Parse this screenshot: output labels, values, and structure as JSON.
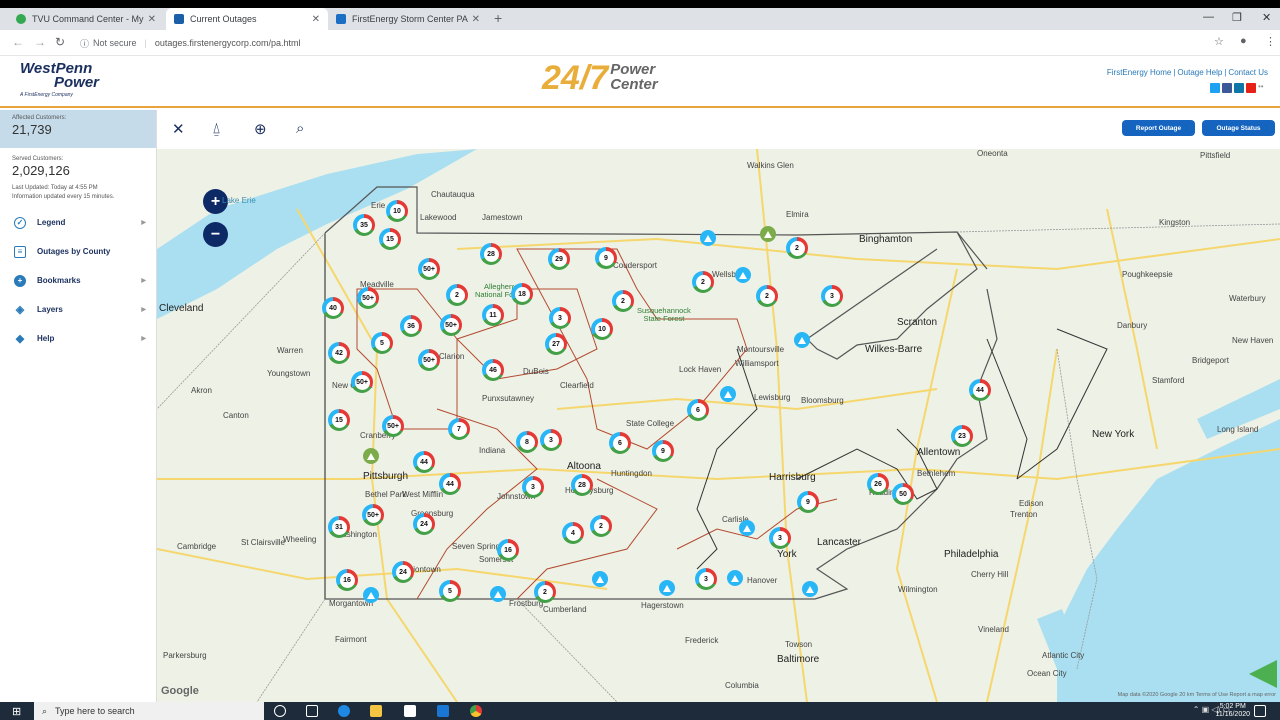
{
  "browser": {
    "tabs": [
      {
        "title": "TVU Command Center - My Rec",
        "favicon_color": "#34a853",
        "active": false
      },
      {
        "title": "Current Outages",
        "favicon_color": "#1a5fa8",
        "active": true
      },
      {
        "title": "FirstEnergy Storm Center PA",
        "favicon_color": "#1a6fc4",
        "active": false
      }
    ],
    "new_tab": "+",
    "security": "Not secure",
    "url": "outages.firstenergycorp.com/pa.html"
  },
  "header": {
    "brand_main_1": "WestPenn",
    "brand_main_2": "Power",
    "brand_sub": "A FirstEnergy Company",
    "center_247": "24/7",
    "center_power": "Power",
    "center_center": "Center",
    "links": [
      "FirstEnergy Home",
      "Outage Help",
      "Contact Us"
    ],
    "link_sep": "|"
  },
  "sidebar": {
    "affected_label": "Affected Customers:",
    "affected_value": "21,739",
    "served_label": "Served Customers:",
    "served_value": "2,029,126",
    "last_updated": "Last Updated: Today at 4:55 PM",
    "update_note": "Information updated every 15 minutes.",
    "menu": [
      {
        "label": "Legend",
        "icon": "legend-icon",
        "arrow": true
      },
      {
        "label": "Outages by County",
        "icon": "list-icon",
        "arrow": false
      },
      {
        "label": "Bookmarks",
        "icon": "bookmark-icon",
        "arrow": true
      },
      {
        "label": "Layers",
        "icon": "layers-icon",
        "arrow": true
      },
      {
        "label": "Help",
        "icon": "help-icon",
        "arrow": true
      }
    ]
  },
  "toolbar": {
    "report_outage": "Report Outage",
    "outage_status": "Outage Status"
  },
  "map": {
    "zoom_in": "+",
    "zoom_out": "−",
    "google": "Google",
    "attribution": "Map data ©2020 Google   20 km   Terms of Use   Report a map error",
    "labels": [
      {
        "text": "Cleveland",
        "big": true
      },
      {
        "text": "Akron",
        "big": false
      },
      {
        "text": "Canton",
        "big": false
      },
      {
        "text": "Youngstown",
        "big": false
      },
      {
        "text": "Warren",
        "big": false
      },
      {
        "text": "Erie",
        "big": false
      },
      {
        "text": "Jamestown",
        "big": false
      },
      {
        "text": "Chautauqua",
        "big": false
      },
      {
        "text": "Lakewood",
        "big": false
      },
      {
        "text": "Meadville",
        "big": false
      },
      {
        "text": "New Castle",
        "big": false
      },
      {
        "text": "Cranberry",
        "big": false
      },
      {
        "text": "Pittsburgh",
        "big": true
      },
      {
        "text": "Bethel Park",
        "big": false
      },
      {
        "text": "West Mifflin",
        "big": false
      },
      {
        "text": "Greensburg",
        "big": false
      },
      {
        "text": "Washington",
        "big": false
      },
      {
        "text": "Wheeling",
        "big": false
      },
      {
        "text": "St Clairsville",
        "big": false
      },
      {
        "text": "Cambridge",
        "big": false
      },
      {
        "text": "Morgantown",
        "big": false
      },
      {
        "text": "Fairmont",
        "big": false
      },
      {
        "text": "Parkersburg",
        "big": false
      },
      {
        "text": "Uniontown",
        "big": false
      },
      {
        "text": "Somerset",
        "big": false
      },
      {
        "text": "Seven Springs",
        "big": false
      },
      {
        "text": "Johnstown",
        "big": false
      },
      {
        "text": "Altoona",
        "big": true
      },
      {
        "text": "Hollidaysburg",
        "big": false
      },
      {
        "text": "Huntingdon",
        "big": false
      },
      {
        "text": "Indiana",
        "big": false
      },
      {
        "text": "Punxsutawney",
        "big": false
      },
      {
        "text": "DuBois",
        "big": false
      },
      {
        "text": "Clearfield",
        "big": false
      },
      {
        "text": "Clarion",
        "big": false
      },
      {
        "text": "State College",
        "big": false
      },
      {
        "text": "Lock Haven",
        "big": false
      },
      {
        "text": "Williamsport",
        "big": false
      },
      {
        "text": "Montoursville",
        "big": false
      },
      {
        "text": "Lewisburg",
        "big": false
      },
      {
        "text": "Bloomsburg",
        "big": false
      },
      {
        "text": "Wellsboro",
        "big": false
      },
      {
        "text": "Coudersport",
        "big": false
      },
      {
        "text": "Elmira",
        "big": false
      },
      {
        "text": "Binghamton",
        "big": true
      },
      {
        "text": "Walkins Glen",
        "big": false
      },
      {
        "text": "Scranton",
        "big": true
      },
      {
        "text": "Wilkes-Barre",
        "big": true
      },
      {
        "text": "Allentown",
        "big": true
      },
      {
        "text": "Bethlehem",
        "big": false
      },
      {
        "text": "Reading",
        "big": false
      },
      {
        "text": "Harrisburg",
        "big": true
      },
      {
        "text": "Lancaster",
        "big": true
      },
      {
        "text": "York",
        "big": true
      },
      {
        "text": "Carlisle",
        "big": false
      },
      {
        "text": "Hanover",
        "big": false
      },
      {
        "text": "Frostburg",
        "big": false
      },
      {
        "text": "Cumberland",
        "big": false
      },
      {
        "text": "Hagerstown",
        "big": false
      },
      {
        "text": "Frederick",
        "big": false
      },
      {
        "text": "Towson",
        "big": false
      },
      {
        "text": "Baltimore",
        "big": true
      },
      {
        "text": "Columbia",
        "big": false
      },
      {
        "text": "Philadelphia",
        "big": true
      },
      {
        "text": "Cherry Hill",
        "big": false
      },
      {
        "text": "Wilmington",
        "big": false
      },
      {
        "text": "Vineland",
        "big": false
      },
      {
        "text": "Trenton",
        "big": false
      },
      {
        "text": "New York",
        "big": true
      },
      {
        "text": "Stamford",
        "big": false
      },
      {
        "text": "Bridgeport",
        "big": false
      },
      {
        "text": "Danbury",
        "big": false
      },
      {
        "text": "Poughkeepsie",
        "big": false
      },
      {
        "text": "Kingston",
        "big": false
      },
      {
        "text": "Pittsfield",
        "big": false
      },
      {
        "text": "Waterbury",
        "big": false
      },
      {
        "text": "New Haven",
        "big": false
      },
      {
        "text": "Long Island",
        "big": false
      },
      {
        "text": "Oneonta",
        "big": false
      },
      {
        "text": "Edison",
        "big": false
      },
      {
        "text": "Atlantic City",
        "big": false
      },
      {
        "text": "Ocean City",
        "big": false
      },
      {
        "text": "Lake Erie",
        "big": false
      }
    ],
    "parks": [
      {
        "line1": "Allegheny",
        "line2": "National Forest"
      },
      {
        "line1": "Susquehannock",
        "line2": "State Forest"
      }
    ],
    "outage_markers": [
      "10",
      "35",
      "15",
      "28",
      "29",
      "9",
      "2",
      "2",
      "50+",
      "2",
      "18",
      "2",
      "2",
      "3",
      "40",
      "50+",
      "36",
      "50+",
      "11",
      "3",
      "10",
      "5",
      "27",
      "42",
      "50+",
      "46",
      "50+",
      "15",
      "7",
      "8",
      "3",
      "6",
      "9",
      "6",
      "44",
      "50+",
      "44",
      "28",
      "3",
      "44",
      "23",
      "26",
      "50",
      "31",
      "50+",
      "24",
      "4",
      "2",
      "16",
      "9",
      "3",
      "24",
      "16",
      "5",
      "2",
      "3"
    ],
    "triangle_markers": 12
  },
  "taskbar": {
    "search_placeholder": "Type here to search",
    "time": "5:02 PM",
    "date": "11/16/2020"
  }
}
